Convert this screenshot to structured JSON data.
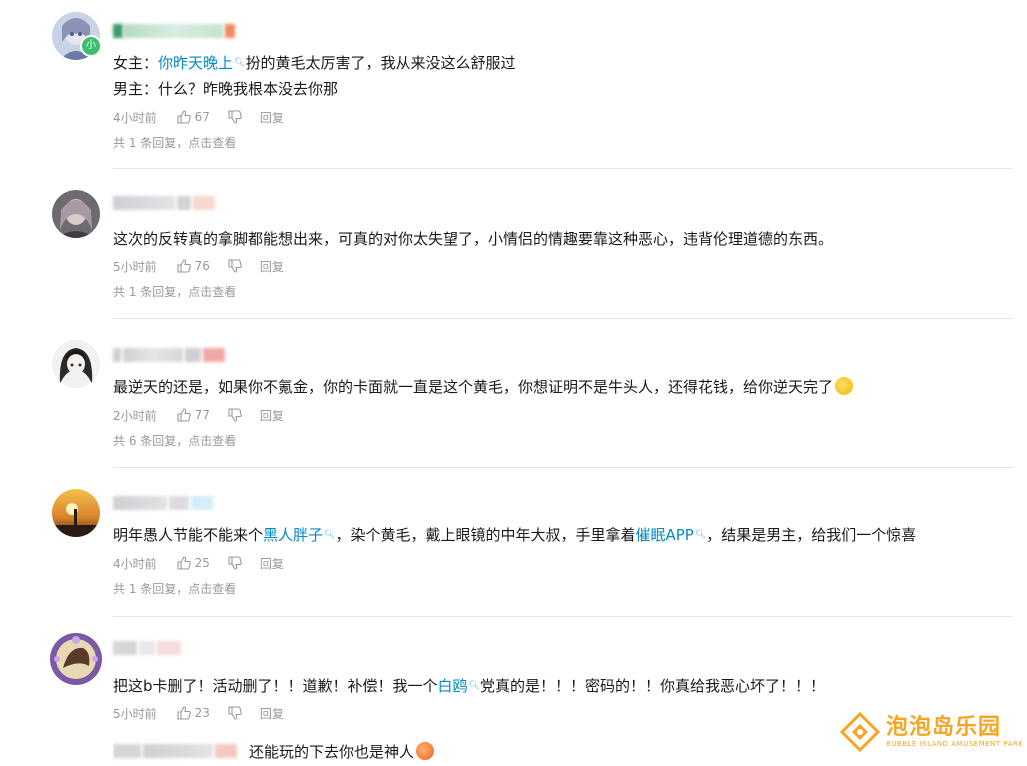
{
  "comments": [
    {
      "line1_a": "女主：",
      "line1_kw": "你昨天晚上",
      "line1_b": "扮的黄毛太厉害了，我从来没这么舒服过",
      "line2": "男主：什么？昨晚我根本没去你那",
      "time": "4小时前",
      "likes": "67",
      "reply": "回复",
      "sub_count": "共 1 条回复，",
      "sub_click": "点击查看",
      "level": "小"
    },
    {
      "text": "这次的反转真的拿脚都能想出来，可真的对你太失望了，小情侣的情趣要靠这种恶心，违背伦理道德的东西。",
      "time": "5小时前",
      "likes": "76",
      "reply": "回复",
      "sub_count": "共 1 条回复，",
      "sub_click": "点击查看"
    },
    {
      "text": "最逆天的还是，如果你不氪金，你的卡面就一直是这个黄毛，你想证明不是牛头人，还得花钱，给你逆天完了",
      "time": "2小时前",
      "likes": "77",
      "reply": "回复",
      "sub_count": "共 6 条回复，",
      "sub_click": "点击查看"
    },
    {
      "text_a": "明年愚人节能不能来个",
      "kw1": "黑人胖子",
      "text_b": "，染个黄毛，戴上眼镜的中年大叔，手里拿着",
      "kw2": "催眠APP",
      "text_c": "，结果是男主，给我们一个惊喜",
      "time": "4小时前",
      "likes": "25",
      "reply": "回复",
      "sub_count": "共 1 条回复，",
      "sub_click": "点击查看"
    },
    {
      "text_a": "把这b卡删了！活动删了！！道歉！补偿！我一个",
      "kw": "白鸥",
      "text_b": "党真的是！！！密码的！！你真给我恶心坏了！！！",
      "time": "5小时前",
      "likes": "23",
      "reply": "回复"
    }
  ],
  "partial_comment": {
    "text": "还能玩的下去你也是神人"
  },
  "watermark": {
    "main": "泡泡岛乐园",
    "sub": "BUBBLE ISLAND AMUSEMENT PARK"
  },
  "colors": {
    "keyword": "#008ac5",
    "meta": "#9499a0",
    "watermark": "#f5a623"
  }
}
